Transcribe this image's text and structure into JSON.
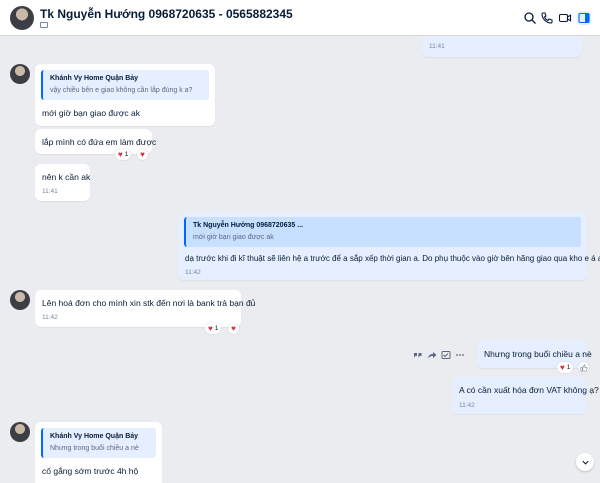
{
  "header": {
    "contact_name": "Tk Nguyễn Hướng 0968720635 - 0565882345",
    "icons": [
      "search-icon",
      "phone-icon",
      "video-call-icon",
      "sidebar-toggle-icon"
    ]
  },
  "messages": {
    "m0": {
      "time": "11:41"
    },
    "m1": {
      "quote_author": "Khánh Vy Home Quận Bảy",
      "quote_text": "vậy chiều bên e giao không cần lắp đúng k a?",
      "text": "mới giờ bạn giao được ak"
    },
    "m2": {
      "text": "lắp mình có đứa em làm được",
      "reaction_count": "1"
    },
    "m3": {
      "text": "nên k cần ak",
      "time": "11:41"
    },
    "m4": {
      "quote_author": "Tk Nguyễn Hướng 0968720635 ...",
      "quote_text": "mới giờ bạn giao được ak",
      "text": "dạ trước khi đi kĩ thuật sẽ liên hệ a trước để a sắp xếp thời gian a. Do phụ thuộc vào giờ bên hãng giao qua kho e á a",
      "time": "11:42"
    },
    "m5": {
      "text": "Lên hoá đơn cho mình xin stk đến nơi là bank trả bạn đủ",
      "time": "11:42",
      "reaction_count": "1"
    },
    "m6": {
      "text": "Nhưng trong buổi chiều a nè",
      "reaction_count": "1"
    },
    "m7": {
      "text": "A có cần xuất hóa đơn VAT không ạ?",
      "time": "11:42"
    },
    "m8": {
      "quote_author": "Khánh Vy Home Quận Bảy",
      "quote_text": "Nhưng trong buổi chiều a nè",
      "text": "cố gắng sớm trước 4h hộ"
    }
  },
  "colors": {
    "accent": "#0068ff",
    "my_bubble": "#e5efff",
    "their_bubble": "#ffffff",
    "background": "#ebecf0",
    "heart": "#e5283b"
  }
}
